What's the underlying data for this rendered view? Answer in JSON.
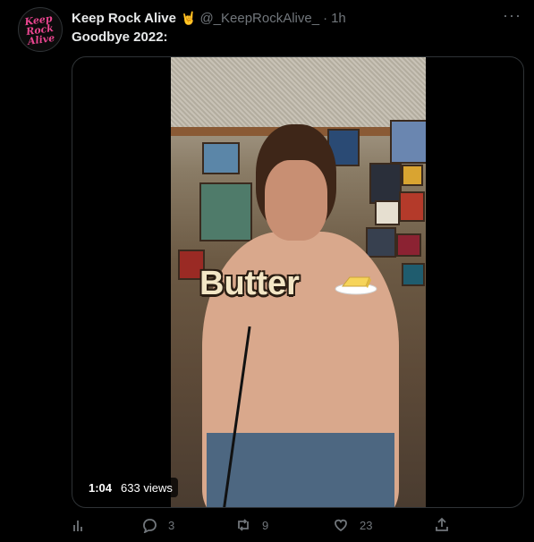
{
  "tweet": {
    "avatar_text": "Keep\nRock\nAlive",
    "author_name": "Keep Rock Alive",
    "author_emoji": "🤘",
    "handle": "@_KeepRockAlive_",
    "separator": "·",
    "timestamp": "1h",
    "more": "···",
    "text": "Goodbye 2022:"
  },
  "media": {
    "caption": "Butter",
    "duration": "1:04",
    "views": "633 views"
  },
  "actions": {
    "replies": "3",
    "retweets": "9",
    "likes": "23"
  },
  "icons": [
    "analytics-icon",
    "reply-icon",
    "retweet-icon",
    "like-icon",
    "share-icon",
    "more-icon",
    "butter-icon",
    "rock-hand-icon"
  ]
}
